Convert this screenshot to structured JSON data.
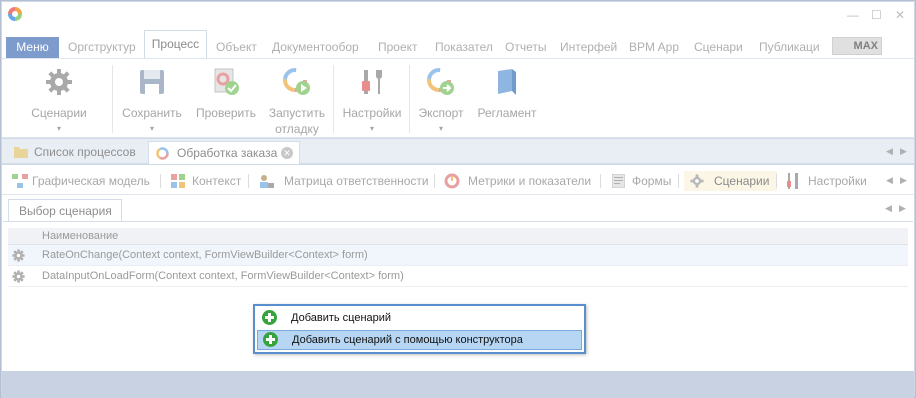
{
  "window": {
    "controls": {
      "minimize": "—",
      "maximize": "☐",
      "close": "✕"
    }
  },
  "ribbon_tabs": {
    "menu": "Меню",
    "tabs": [
      "Оргструктур",
      "Процесс",
      "Объект",
      "Документообор",
      "Проект",
      "Показател",
      "Отчеты",
      "Интерфей",
      "BPM App",
      "Сценари",
      "Публикаци"
    ],
    "active": "Процесс",
    "max_label": "MAX"
  },
  "ribbon": {
    "buttons": [
      {
        "label": "Сценарии",
        "label2": "",
        "icon": "gear-icon",
        "dropdown": true
      },
      {
        "label": "Сохранить",
        "label2": "",
        "icon": "save-icon",
        "dropdown": true
      },
      {
        "label": "Проверить",
        "label2": "",
        "icon": "check-icon",
        "dropdown": false
      },
      {
        "label": "Запустить",
        "label2": "отладку",
        "icon": "run-debug-icon",
        "dropdown": false
      },
      {
        "label": "Настройки",
        "label2": "",
        "icon": "tools-icon",
        "dropdown": true
      },
      {
        "label": "Экспорт",
        "label2": "",
        "icon": "export-icon",
        "dropdown": true
      },
      {
        "label": "Регламент",
        "label2": "",
        "icon": "book-icon",
        "dropdown": false
      }
    ]
  },
  "doc_tabs": {
    "tabs": [
      {
        "label": "Список процессов",
        "icon": "folder-icon"
      },
      {
        "label": "Обработка заказа",
        "icon": "process-icon",
        "closable": true
      }
    ]
  },
  "sub_tabs": {
    "tabs": [
      "Графическая модель",
      "Контекст",
      "Матрица ответственности",
      "Метрики и показатели",
      "Формы",
      "Сценарии",
      "Настройки"
    ],
    "active": "Сценарии"
  },
  "content": {
    "tab": "Выбор сценария",
    "grid": {
      "header": "Наименование",
      "rows": [
        "RateOnChange(Context context, FormViewBuilder<Context> form)",
        "DataInputOnLoadForm(Context context, FormViewBuilder<Context> form)"
      ]
    }
  },
  "popup": {
    "items": [
      "Добавить сценарий",
      "Добавить сценарий с помощью конструктора"
    ]
  },
  "colors": {
    "accent": "#7d9bcd",
    "popup_border": "#5a8fcf",
    "highlight": "#b6d6f4",
    "plus_green": "#36a33c"
  }
}
